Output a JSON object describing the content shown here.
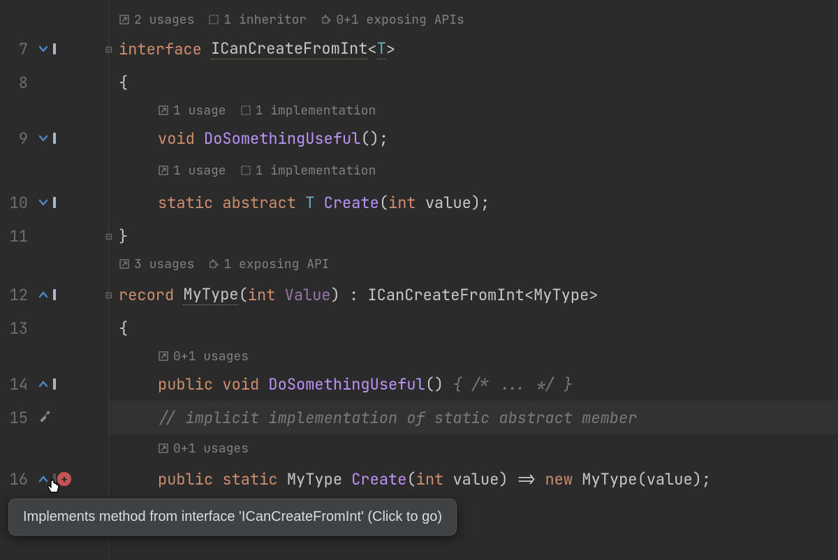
{
  "gutter": {
    "lines": [
      "7",
      "8",
      "9",
      "10",
      "11",
      "12",
      "13",
      "14",
      "15",
      "16"
    ]
  },
  "codelens": {
    "interface": {
      "usages": "2 usages",
      "inheritor": "1 inheritor",
      "exposing": "0+1 exposing APIs"
    },
    "doSomething": {
      "usages": "1 usage",
      "impl": "1 implementation"
    },
    "createAbstract": {
      "usages": "1 usage",
      "impl": "1 implementation"
    },
    "record": {
      "usages": "3 usages",
      "exposing": "1 exposing API"
    },
    "doSomethingImpl": {
      "usages": "0+1 usages"
    },
    "createImpl": {
      "usages": "0+1 usages"
    }
  },
  "code": {
    "kw_interface": "interface",
    "iface_name": "ICanCreateFromInt",
    "lt": "<",
    "T": "T",
    "gt": ">",
    "open_brace": "{",
    "close_brace": "}",
    "kw_void": "void",
    "method_do": "DoSomethingUseful",
    "parens": "()",
    "semi": ";",
    "kw_static": "static",
    "kw_abstract": "abstract",
    "T2": "T",
    "method_create": "Create",
    "open_paren": "(",
    "kw_int": "int",
    "param_value": "value",
    "close_paren": ")",
    "kw_record": "record",
    "record_name": "MyType",
    "record_field": "Value",
    "colon": " : ",
    "kw_public": "public",
    "body_inline": " { /* ... */ }",
    "comment_line": "// implicit implementation of static abstract member",
    "arrow": " => ",
    "kw_new": "new"
  },
  "tooltip": {
    "text": "Implements method from interface 'ICanCreateFromInt' (Click to go)"
  }
}
